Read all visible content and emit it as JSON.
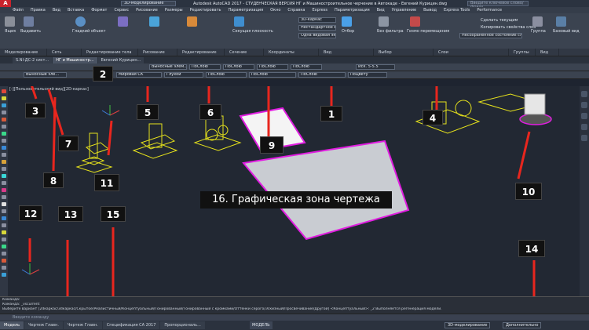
{
  "titlebar": {
    "workspace": "3D-моделирование",
    "title": "Autodesk AutoCAD 2017 - СТУДЕНЧЕСКАЯ ВЕРСИЯ   НГ и Машиностроительное черчение в Автокаде - Евгений Курицин.dwg",
    "search_placeholder": "Введите ключевое слово/фразу"
  },
  "menubar": [
    "Файл",
    "Правка",
    "Вид",
    "Вставка",
    "Формат",
    "Сервис",
    "Рисование",
    "Размеры",
    "Редактировать",
    "Параметризация",
    "Окно",
    "Справка",
    "Express",
    "Параметризация",
    "Вид",
    "Управление",
    "Вывод",
    "Express Tools",
    "Performance"
  ],
  "ribbon": {
    "buttons": {
      "box": "Ящик",
      "extrude": "Выдавить",
      "smooth": "Гладкий объект",
      "slice": "Сечение плоскостью",
      "gizmo": "Гизмо перемещения",
      "filter": "Без фильтра",
      "group": "Группа",
      "base_view": "Базовый вид",
      "section_plane": "Секущая плоскость",
      "view3d": "3D-каркас",
      "ortho": "Отбор",
      "lineweight": "Нестандартное вращ...",
      "ucs": "Одна видовая экран...",
      "layer_unsaved": "Несохраненное состояние слоя",
      "make_current": "Сделать текущим",
      "match_layer": "Копировать свойства слоя"
    },
    "panels": [
      "Моделирование",
      "Сеть",
      "Редактирование тела",
      "Рисование",
      "Редактирование",
      "Сечение",
      "Координаты",
      "Вид",
      "Выбор",
      "Слои",
      "Группы",
      "Вид"
    ]
  },
  "filetabs": [
    "S.NI-ДС-2 сист...",
    "НГ и Машиностр...",
    "Евгений Курицин..."
  ],
  "prop_row1": [
    "Выносные элем...",
    "ПоСлою",
    "ПоСлою",
    "ПоСлою",
    "ПоСлою",
    "Иск. 5-5.5"
  ],
  "prop_row2": [
    "Выносные эле...",
    "Мировая СК",
    "Глухой",
    "ПоСлою",
    "ПоСлою",
    "ПоСлою",
    "ПоЦвету"
  ],
  "viewport_label": "[-][Пользовательский вид][2D-каркас]",
  "headline": "16. Графическая зона чертежа",
  "badges": [
    "1",
    "2",
    "3",
    "4",
    "5",
    "6",
    "7",
    "8",
    "9",
    "10",
    "11",
    "12",
    "13",
    "14",
    "15"
  ],
  "command": {
    "line1": "Команда:",
    "line2": "Команда:  _vscurrent",
    "line3": "Выберите вариант [2dкаркас/3dкаркас/Скрытое/Реалистичный/Концептуальный/Тонированный/Тонированный с кромками/Оттенки серого/Эскизный/Просвечивание/Другой] <Концептуальный>: _2 Выполняется регенерация модели.",
    "input_placeholder": "Введите команду"
  },
  "layouttabs": [
    "Модель",
    "Чертеж Главн.",
    "Чертеж Главн.",
    "Спецификация СА 2017",
    "Пропорциональ..."
  ],
  "status": {
    "model": "МОДЕЛЬ",
    "workspace": "3D-моделирование",
    "extra": "Дополнительно"
  },
  "colors": {
    "accent_red": "#c8232c",
    "highlight_magenta": "#e01de0",
    "wireframe_yellow": "#e6e21c"
  }
}
